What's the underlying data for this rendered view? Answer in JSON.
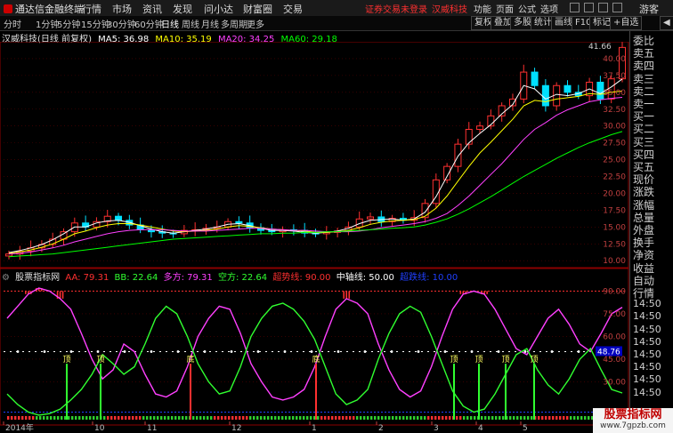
{
  "menubar": {
    "app_name": "通达信金融终端",
    "items": [
      "行情",
      "市场",
      "资讯",
      "发现",
      "问小达",
      "财富圈",
      "交易"
    ],
    "login_status": "证券交易未登录",
    "stock_tag": "汉威科技",
    "right_items": [
      "功能",
      "页面",
      "公式",
      "选项"
    ],
    "guest": "游客"
  },
  "toolbar": {
    "periods": [
      "分时",
      "1分钟",
      "5分钟",
      "15分钟",
      "30分钟",
      "60分钟",
      "日线",
      "周线",
      "月线",
      "多周期",
      "更多"
    ],
    "active": "日线",
    "buttons": [
      "复权",
      "叠加",
      "多股",
      "统计",
      "画线",
      "F10",
      "标记",
      "+自选",
      "◀"
    ]
  },
  "stock": {
    "title": "汉威科技(日线 前复权)",
    "ma": [
      {
        "label": "MA5: 36.98",
        "color": "#ffffff"
      },
      {
        "label": "MA10: 35.19",
        "color": "#ffff00"
      },
      {
        "label": "MA20: 34.25",
        "color": "#ff40ff"
      },
      {
        "label": "MA60: 29.18",
        "color": "#00ff00"
      }
    ],
    "last_price_label": "41.66"
  },
  "indicator": {
    "name": "股票指标网",
    "items": [
      {
        "label": "AA: 79.31",
        "color": "#ff3030"
      },
      {
        "label": "BB: 22.64",
        "color": "#30ff30"
      },
      {
        "label": "多方: 79.31",
        "color": "#ff40ff"
      },
      {
        "label": "空方: 22.64",
        "color": "#30ff30"
      },
      {
        "label": "超势线: 90.00",
        "color": "#ff3030"
      },
      {
        "label": "中轴线: 50.00",
        "color": "#ffffff"
      },
      {
        "label": "超跌线: 10.00",
        "color": "#2040ff"
      }
    ],
    "top_label": "顶",
    "bottom_label": "底",
    "current_label": "48.76"
  },
  "chart_data": [
    {
      "type": "candlestick",
      "title": "汉威科技(日线 前复权)",
      "y_ticks": [
        10.0,
        12.5,
        15.0,
        17.5,
        20.0,
        22.5,
        25.0,
        27.5,
        30.0,
        32.5,
        35.0,
        37.5,
        40.0
      ],
      "ylim": [
        9.5,
        42.5
      ],
      "series": [
        {
          "name": "收盘",
          "values": [
            11.0,
            11.4,
            11.9,
            12.4,
            13.2,
            14.3,
            15.6,
            15.0,
            15.8,
            16.6,
            16.0,
            15.3,
            14.6,
            14.3,
            14.1,
            14.0,
            14.5,
            14.6,
            14.8,
            15.0,
            15.8,
            15.6,
            14.9,
            14.5,
            14.3,
            14.6,
            14.5,
            14.1,
            14.0,
            14.2,
            14.4,
            15.0,
            16.2,
            16.5,
            15.8,
            16.3,
            16.0,
            16.4,
            18.5,
            22.0,
            24.0,
            27.3,
            29.5,
            30.0,
            31.5,
            33.0,
            34.0,
            38.0,
            36.0,
            33.0,
            36.0,
            35.0,
            34.5,
            36.5,
            34.0,
            37.0,
            41.66
          ]
        },
        {
          "name": "MA5",
          "values": [
            11.2,
            11.5,
            11.9,
            12.4,
            13.1,
            14.0,
            15.0,
            15.0,
            15.6,
            15.9,
            16.0,
            15.7,
            15.2,
            14.7,
            14.3,
            14.1,
            14.3,
            14.5,
            14.7,
            15.0,
            15.4,
            15.5,
            15.2,
            14.8,
            14.5,
            14.5,
            14.4,
            14.2,
            14.1,
            14.2,
            14.4,
            14.8,
            15.5,
            16.0,
            16.1,
            16.2,
            16.0,
            16.2,
            17.2,
            19.5,
            22.5,
            25.5,
            27.5,
            28.9,
            30.2,
            31.8,
            33.2,
            36.0,
            35.5,
            34.0,
            34.7,
            34.5,
            34.8,
            35.5,
            34.8,
            35.8,
            36.98
          ]
        },
        {
          "name": "MA10",
          "values": [
            11.1,
            11.3,
            11.6,
            12.0,
            12.5,
            13.2,
            14.0,
            14.4,
            14.9,
            15.3,
            15.5,
            15.5,
            15.3,
            15.0,
            14.7,
            14.4,
            14.3,
            14.4,
            14.5,
            14.7,
            15.0,
            15.2,
            15.1,
            14.9,
            14.7,
            14.6,
            14.5,
            14.4,
            14.2,
            14.2,
            14.3,
            14.5,
            14.9,
            15.4,
            15.7,
            15.9,
            16.0,
            16.1,
            16.6,
            17.8,
            19.6,
            21.8,
            24.0,
            26.0,
            27.6,
            29.3,
            31.0,
            33.0,
            33.8,
            33.6,
            34.0,
            34.2,
            34.4,
            34.8,
            34.7,
            35.0,
            35.19
          ]
        },
        {
          "name": "MA20",
          "values": [
            11.0,
            11.1,
            11.3,
            11.6,
            11.9,
            12.3,
            12.8,
            13.2,
            13.6,
            14.0,
            14.3,
            14.5,
            14.6,
            14.6,
            14.6,
            14.5,
            14.4,
            14.4,
            14.4,
            14.5,
            14.6,
            14.7,
            14.8,
            14.8,
            14.7,
            14.6,
            14.5,
            14.5,
            14.4,
            14.3,
            14.3,
            14.3,
            14.4,
            14.6,
            14.9,
            15.1,
            15.3,
            15.5,
            15.8,
            16.3,
            17.0,
            18.2,
            19.6,
            21.2,
            22.8,
            24.4,
            26.2,
            28.0,
            29.5,
            30.5,
            31.6,
            32.4,
            33.0,
            33.6,
            33.9,
            34.1,
            34.25
          ]
        },
        {
          "name": "MA60",
          "values": [
            10.6,
            10.7,
            10.8,
            10.9,
            11.0,
            11.2,
            11.4,
            11.6,
            11.8,
            12.0,
            12.2,
            12.4,
            12.6,
            12.8,
            13.0,
            13.2,
            13.3,
            13.4,
            13.5,
            13.6,
            13.7,
            13.8,
            13.9,
            14.0,
            14.0,
            14.1,
            14.1,
            14.2,
            14.2,
            14.3,
            14.3,
            14.4,
            14.5,
            14.6,
            14.7,
            14.8,
            14.9,
            15.0,
            15.3,
            15.7,
            16.2,
            16.9,
            17.7,
            18.6,
            19.5,
            20.5,
            21.5,
            22.5,
            23.4,
            24.3,
            25.2,
            26.0,
            26.8,
            27.5,
            28.1,
            28.7,
            29.18
          ]
        }
      ]
    },
    {
      "type": "line",
      "title": "股票指标网",
      "y_ticks": [
        30.0,
        45.0,
        60.0,
        75.0,
        90.0
      ],
      "ylim": [
        5,
        102
      ],
      "x_labels": [
        "2014年",
        "10",
        "11",
        "12",
        "1",
        "2",
        "3",
        "4",
        "5"
      ],
      "series": [
        {
          "name": "多方",
          "values": [
            72,
            80,
            88,
            92,
            90,
            85,
            78,
            62,
            45,
            32,
            38,
            55,
            50,
            35,
            22,
            20,
            24,
            40,
            60,
            72,
            80,
            78,
            62,
            42,
            30,
            20,
            18,
            20,
            25,
            40,
            60,
            78,
            85,
            82,
            75,
            55,
            38,
            25,
            20,
            24,
            40,
            60,
            78,
            88,
            90,
            88,
            78,
            65,
            52,
            48,
            60,
            72,
            78,
            68,
            55,
            50,
            62,
            75,
            79.31
          ]
        },
        {
          "name": "空方",
          "values": [
            22,
            15,
            10,
            8,
            9,
            12,
            18,
            25,
            35,
            48,
            42,
            35,
            40,
            55,
            72,
            80,
            75,
            60,
            42,
            30,
            22,
            24,
            40,
            60,
            72,
            80,
            82,
            78,
            70,
            58,
            40,
            22,
            15,
            18,
            25,
            45,
            62,
            75,
            80,
            76,
            60,
            42,
            24,
            14,
            10,
            12,
            22,
            35,
            48,
            52,
            38,
            28,
            22,
            32,
            45,
            52,
            38,
            25,
            22.64
          ]
        },
        {
          "name": "超势线",
          "values": [
            90
          ]
        },
        {
          "name": "中轴线",
          "values": [
            50
          ]
        },
        {
          "name": "超跌线",
          "values": [
            10
          ]
        }
      ]
    }
  ],
  "side_panel": {
    "items": [
      "委比",
      "卖五",
      "卖四",
      "卖三",
      "卖二",
      "卖一",
      "买一",
      "买二",
      "买三",
      "买四",
      "买五",
      "现价",
      "涨跌",
      "涨幅",
      "总量",
      "外盘",
      "换手",
      "净资",
      "收益",
      "自动",
      "行情",
      "14:50",
      "14:50",
      "14:50",
      "14:50",
      "14:50",
      "14:50",
      "14:50",
      "14:50"
    ]
  },
  "watermark": {
    "line1": "股票指标网",
    "line2": "www.7gpzb.com"
  },
  "colors": {
    "up": "#ff3030",
    "down": "#00e0ff",
    "grid": "#8b0000",
    "bg": "#000000"
  }
}
